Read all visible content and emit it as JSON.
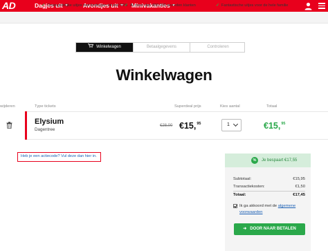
{
  "brand": {
    "logo": "AD",
    "accent": "#e8001c",
    "success": "#2aa84a"
  },
  "nav": {
    "items": [
      {
        "label": "Dagjes uit"
      },
      {
        "label": "Avondjes uit"
      },
      {
        "label": "Minivakanties"
      }
    ]
  },
  "usps": [
    "Onvergetelijke uitjes met kortingen tot wel 50%",
    "Al meer dan 400.000 tevreden klanten",
    "Fantastische uitjes voor de hele familie"
  ],
  "steps": [
    "Winkelwagen",
    "Betaalgegevens",
    "Controleren"
  ],
  "page_title": "Winkelwagen",
  "table": {
    "headers": {
      "remove": "erwijderen",
      "type": "Type tickets",
      "price": "Superdeal prijs",
      "qty": "Kies aantal",
      "total": "Totaal"
    },
    "item": {
      "name": "Elysium",
      "subtitle": "Dagentree",
      "old_price": "€28,00",
      "price_main": "€15,",
      "price_cents": "95",
      "qty": "1",
      "total_main": "€15,",
      "total_cents": "95"
    }
  },
  "coupon_link": "Heb je een actiecode? Vul deze dan hier in.",
  "summary": {
    "saving_badge": "%",
    "saving_text": "Je bespaart €17,55",
    "subtotal_label": "Subtotaal:",
    "subtotal_value": "€15,95",
    "fee_label": "Transactiekosten:",
    "fee_value": "€1,50",
    "total_label": "Totaal:",
    "total_value": "€17,45",
    "agree_prefix": "Ik ga akkoord met de ",
    "agree_link": "algemene voorwaarden",
    "pay_button": "DOOR NAAR BETALEN"
  }
}
